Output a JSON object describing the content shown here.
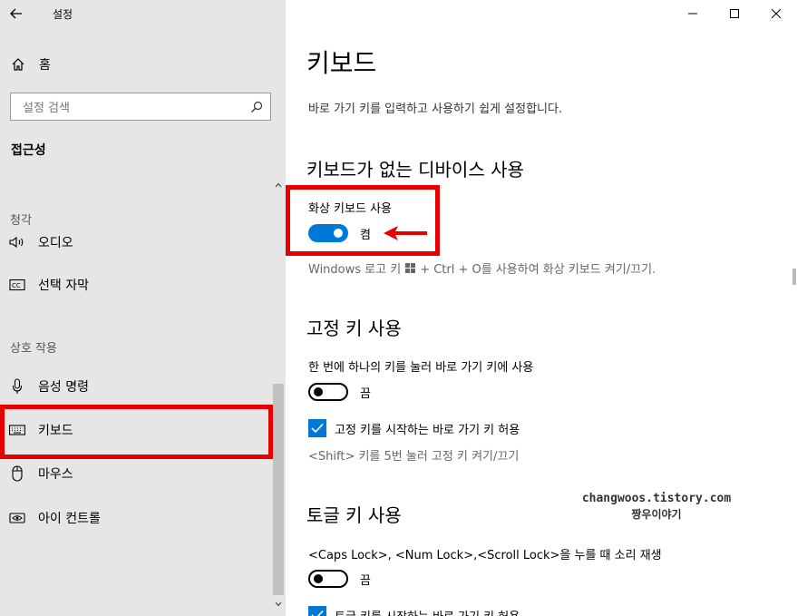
{
  "app": {
    "title": "설정"
  },
  "sidebar": {
    "home_label": "홈",
    "search_placeholder": "설정 검색",
    "section_title": "접근성",
    "group_hearing": "청각",
    "group_interaction": "상호 작용",
    "items": [
      {
        "label": "오디오",
        "icon": "speaker-icon"
      },
      {
        "label": "선택 자막",
        "icon": "closed-caption-icon"
      },
      {
        "label": "음성 명령",
        "icon": "microphone-icon"
      },
      {
        "label": "키보드",
        "icon": "keyboard-icon",
        "selected": true
      },
      {
        "label": "마우스",
        "icon": "mouse-icon"
      },
      {
        "label": "아이 컨트롤",
        "icon": "eye-control-icon"
      }
    ]
  },
  "main": {
    "title": "키보드",
    "description": "바로 가기 키를 입력하고 사용하기 쉽게 설정합니다.",
    "section1": {
      "heading": "키보드가 없는 디바이스 사용",
      "label": "화상 키보드 사용",
      "toggle_state": "켬",
      "toggle_on": true,
      "hint_before": "Windows 로고 키",
      "hint_after": "+ Ctrl + O를 사용하여 화상 키보드 켜기/끄기."
    },
    "section2": {
      "heading": "고정 키 사용",
      "label": "한 번에 하나의 키를 눌러 바로 가기 키에 사용",
      "toggle_state": "끔",
      "toggle_on": false,
      "checkbox_label": "고정 키를 시작하는 바로 가기 키 허용",
      "checkbox_checked": true,
      "hint": "<Shift> 키를 5번 눌러 고정 키 켜기/끄기"
    },
    "section3": {
      "heading": "토글 키 사용",
      "label": "<Caps Lock>, <Num Lock>,<Scroll Lock>을 누를 때 소리 재생",
      "toggle_state": "끔",
      "toggle_on": false,
      "checkbox_label": "토글 키를 시작하는 바로 가기 키 허용",
      "checkbox_checked": true
    }
  },
  "watermark": {
    "line1": "changwoos.tistory.com",
    "line2": "짱우이야기"
  },
  "colors": {
    "accent": "#0078d7",
    "highlight": "#e60000",
    "sidebar_bg": "#e6e6e6"
  }
}
